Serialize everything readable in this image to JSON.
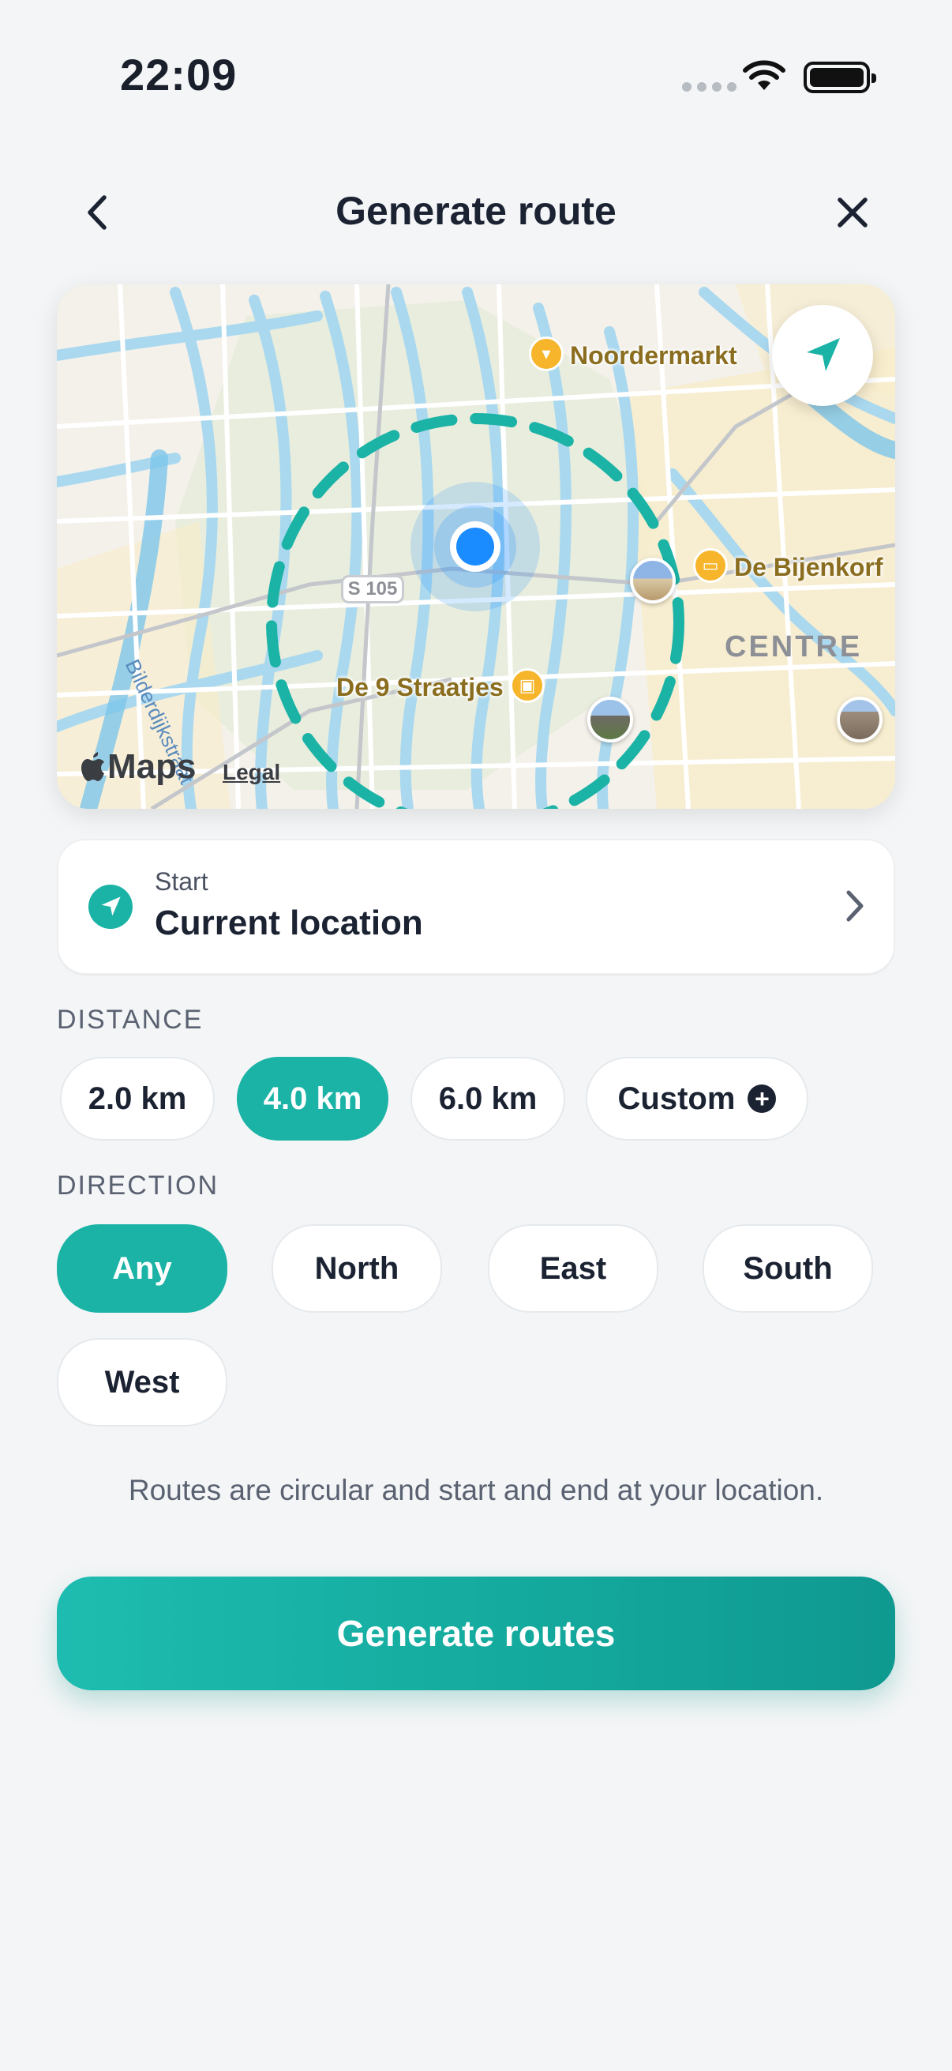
{
  "status_bar": {
    "time": "22:09"
  },
  "header": {
    "title": "Generate route"
  },
  "map": {
    "pois": {
      "noordermarkt": "Noordermarkt",
      "bijenkorf": "De Bijenkorf",
      "straatjes": "De 9 Straatjes"
    },
    "district_label": "CENTRE",
    "road_shield": "S 105",
    "street_label": "Bilderdijkstraat",
    "provider": "Maps",
    "legal": "Legal"
  },
  "start": {
    "label": "Start",
    "value": "Current location"
  },
  "distance": {
    "label": "DISTANCE",
    "options": [
      "2.0 km",
      "4.0 km",
      "6.0 km",
      "Custom"
    ],
    "selected": "4.0 km"
  },
  "direction": {
    "label": "DIRECTION",
    "options": [
      "Any",
      "North",
      "East",
      "South",
      "West"
    ],
    "selected": "Any"
  },
  "note": "Routes are circular and start and end at your location.",
  "generate_button": "Generate routes",
  "colors": {
    "accent": "#1bb3a6",
    "user_dot": "#1a8cff",
    "poi": "#f6b52a"
  }
}
